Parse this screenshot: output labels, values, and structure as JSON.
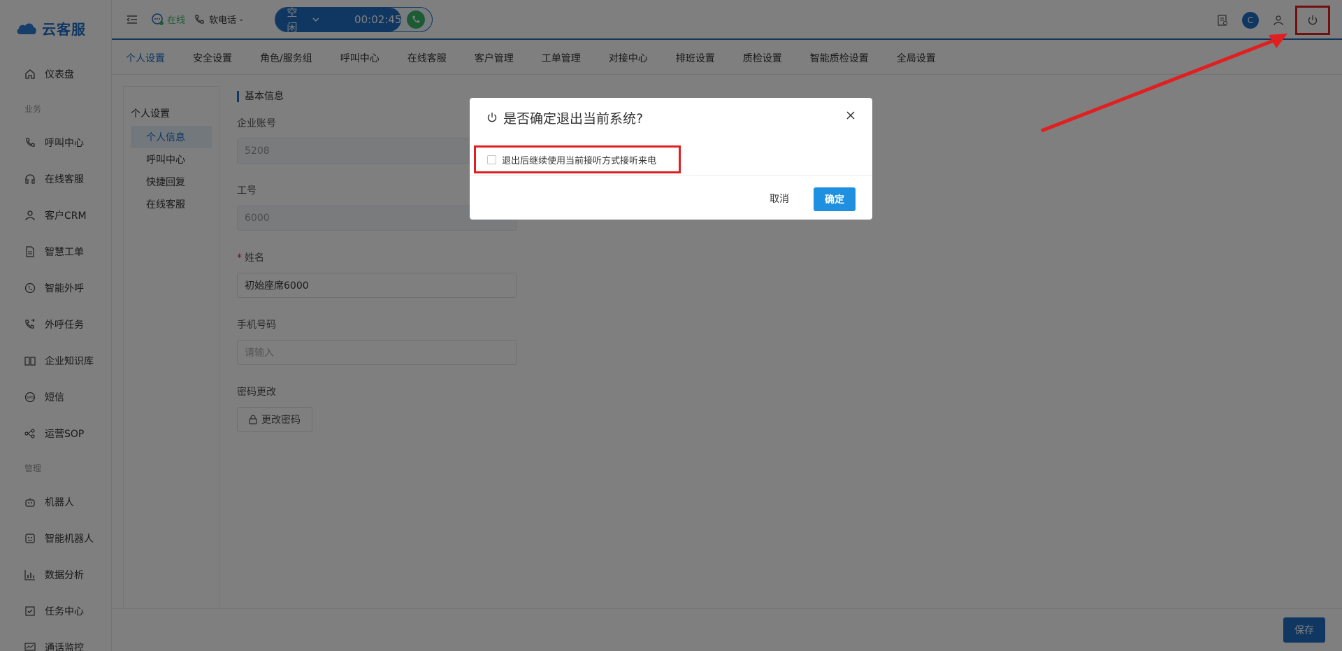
{
  "app": {
    "logo_text": "云客服"
  },
  "sidebar": {
    "items": [
      {
        "label": "仪表盘",
        "icon": "home-icon"
      },
      {
        "group": "业务"
      },
      {
        "label": "呼叫中心",
        "icon": "phone-icon"
      },
      {
        "label": "在线客服",
        "icon": "headset-icon"
      },
      {
        "label": "客户CRM",
        "icon": "user-icon"
      },
      {
        "label": "智慧工单",
        "icon": "document-icon"
      },
      {
        "label": "智能外呼",
        "icon": "whatsapp-phone-icon"
      },
      {
        "label": "外呼任务",
        "icon": "phone-task-icon"
      },
      {
        "label": "企业知识库",
        "icon": "book-icon"
      },
      {
        "label": "短信",
        "icon": "sms-icon"
      },
      {
        "label": "运营SOP",
        "icon": "flow-icon"
      },
      {
        "group": "管理"
      },
      {
        "label": "机器人",
        "icon": "robot-icon"
      },
      {
        "label": "智能机器人",
        "icon": "smart-robot-icon"
      },
      {
        "label": "数据分析",
        "icon": "chart-icon"
      },
      {
        "label": "任务中心",
        "icon": "task-icon"
      },
      {
        "label": "通话监控",
        "icon": "monitor-icon"
      }
    ]
  },
  "topbar": {
    "status": "在线",
    "softphone": "软电话",
    "call_state": "空闲",
    "call_timer": "00:02:45",
    "avatar_letter": "C"
  },
  "tabs": [
    "个人设置",
    "安全设置",
    "角色/服务组",
    "呼叫中心",
    "在线客服",
    "客户管理",
    "工单管理",
    "对接中心",
    "排班设置",
    "质检设置",
    "智能质检设置",
    "全局设置"
  ],
  "submenu": {
    "title": "个人设置",
    "items": [
      "个人信息",
      "呼叫中心",
      "快捷回复",
      "在线客服"
    ]
  },
  "form": {
    "section": "基本信息",
    "account_label": "企业账号",
    "account_value": "5208",
    "job_label": "工号",
    "job_value": "6000",
    "name_label": "姓名",
    "name_value": "初始座席6000",
    "phone_label": "手机号码",
    "phone_placeholder": "请输入",
    "pw_label": "密码更改",
    "pw_button": "更改密码"
  },
  "save_button": "保存",
  "dialog": {
    "title": "是否确定退出当前系统?",
    "checkbox_label": "退出后继续使用当前接听方式接听来电",
    "cancel": "取消",
    "confirm": "确定"
  },
  "colors": {
    "primary": "#1f6fc5",
    "annotation": "#e02020",
    "online": "#3bb66b"
  }
}
